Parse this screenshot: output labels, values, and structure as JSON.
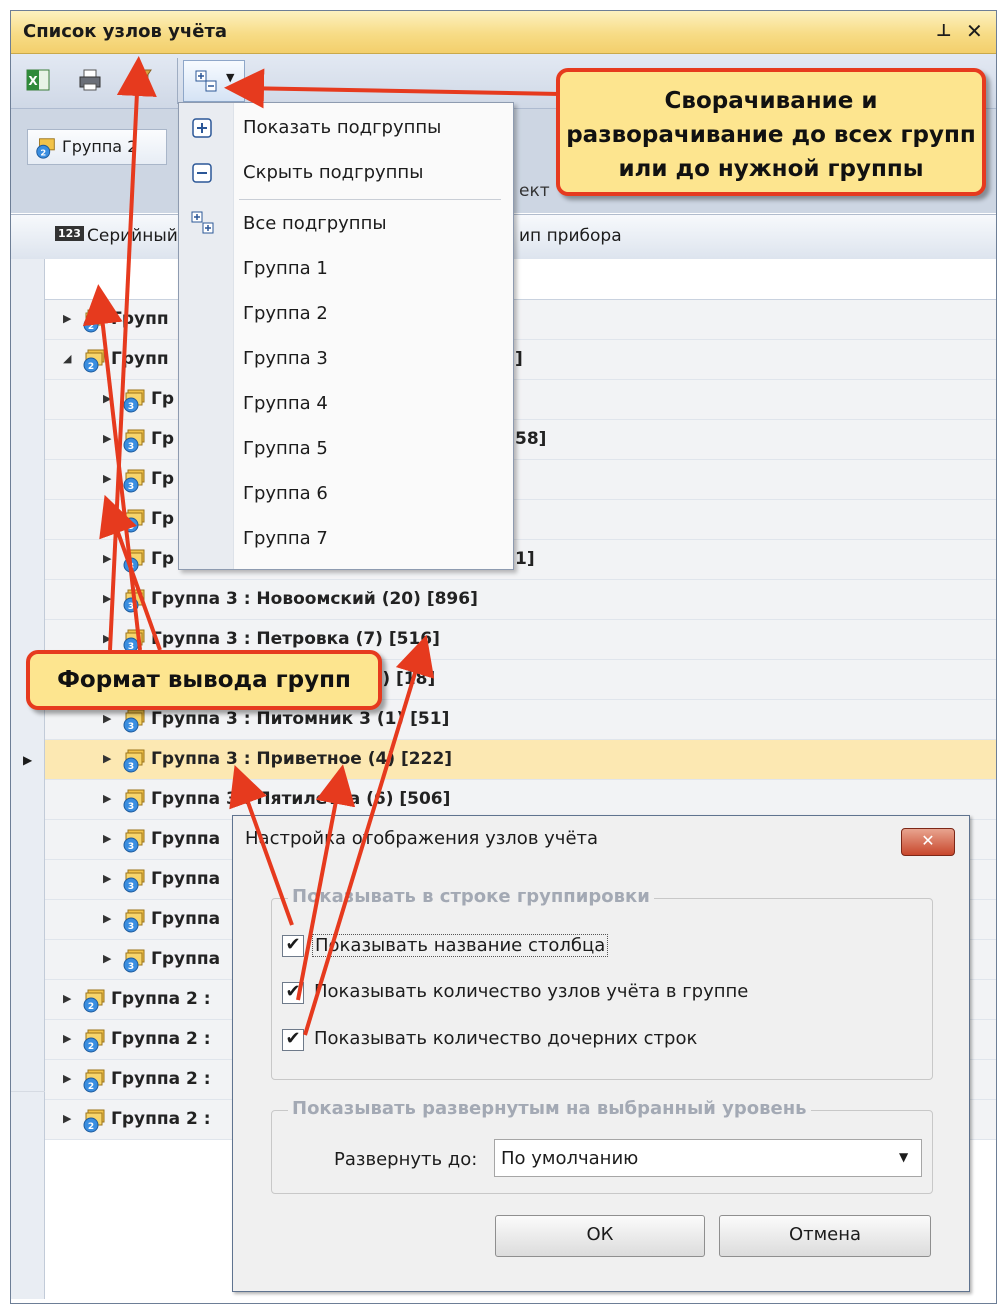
{
  "window": {
    "title": "Список узлов учёта",
    "pin_glyph": "ᵩ",
    "close_glyph": "✕"
  },
  "toolbar": {
    "icons": [
      "excel-export-icon",
      "print-icon",
      "format-settings-icon",
      "expand-collapse-icon"
    ]
  },
  "group_panel": {
    "chip_label": "Группа 2",
    "partial_label": "ект"
  },
  "columns": {
    "serial": "Серийный",
    "device_type": "ип прибора"
  },
  "menu": {
    "show_sub": "Показать подгруппы",
    "hide_sub": "Скрыть подгруппы",
    "all_sub": "Все подгруппы",
    "levels": [
      "Группа 1",
      "Группа 2",
      "Группа 3",
      "Группа 4",
      "Группа 5",
      "Группа 6",
      "Группа 7"
    ]
  },
  "rows": [
    {
      "level": 2,
      "expanded": false,
      "text": "Групп",
      "tail": ""
    },
    {
      "level": 2,
      "expanded": true,
      "text": "Групп",
      "tail": "]"
    },
    {
      "level": 3,
      "expanded": false,
      "text": "Гр",
      "tail": ""
    },
    {
      "level": 3,
      "expanded": false,
      "text": "Гр",
      "tail": "58]"
    },
    {
      "level": 3,
      "expanded": false,
      "text": "Гр",
      "tail": ""
    },
    {
      "level": 3,
      "expanded": false,
      "text": "Гр",
      "tail": ""
    },
    {
      "level": 3,
      "expanded": false,
      "text": "Гр",
      "tail": "1]"
    },
    {
      "level": 3,
      "expanded": false,
      "text": "Группа 3 : Новоомский (20) [896]",
      "tail": ""
    },
    {
      "level": 3,
      "expanded": false,
      "text": "Группа 3 : Петровка (7) [516]",
      "tail": ""
    },
    {
      "level": 3,
      "expanded": false,
      "text": "",
      "tail": "2 (1) [18]"
    },
    {
      "level": 3,
      "expanded": false,
      "text": "Группа 3 : Питомник 3 (1) [51]",
      "tail": ""
    },
    {
      "level": 3,
      "expanded": false,
      "text": "Группа 3 : Приветное (4) [222]",
      "tail": "",
      "selected": true
    },
    {
      "level": 3,
      "expanded": false,
      "text": "Группа 3 : Пятилетка (6) [506]",
      "tail": ""
    },
    {
      "level": 3,
      "expanded": false,
      "text": "Группа",
      "tail": ""
    },
    {
      "level": 3,
      "expanded": false,
      "text": "Группа",
      "tail": ""
    },
    {
      "level": 3,
      "expanded": false,
      "text": "Группа",
      "tail": ""
    },
    {
      "level": 3,
      "expanded": false,
      "text": "Группа",
      "tail": ""
    },
    {
      "level": 2,
      "expanded": false,
      "text": "Группа 2 :",
      "tail": ""
    },
    {
      "level": 2,
      "expanded": false,
      "text": "Группа 2 :",
      "tail": ""
    },
    {
      "level": 2,
      "expanded": false,
      "text": "Группа 2 :",
      "tail": ""
    },
    {
      "level": 2,
      "expanded": false,
      "text": "Группа 2 :",
      "tail": ""
    }
  ],
  "callouts": {
    "expand": "Сворачивание и разворачивание до всех групп или до нужной группы",
    "format": "Формат вывода групп"
  },
  "dialog": {
    "title": "Настройка отображения узлов учёта",
    "close_glyph": "✕",
    "group1_legend": "Показывать в строке группировки",
    "cb1": "Показывать название столбца",
    "cb2": "Показывать количество узлов учёта в группе",
    "cb3": "Показывать количество дочерних строк",
    "check_glyph": "✔",
    "group2_legend": "Показывать развернутым на выбранный уровень",
    "expand_label": "Развернуть до:",
    "expand_value": "По умолчанию",
    "ok": "ОК",
    "cancel": "Отмена"
  },
  "colors": {
    "accent": "#e63a1e",
    "callout_bg": "#fde58f",
    "selected_row": "#fce8b2",
    "title_bar": "#f7dc86"
  }
}
